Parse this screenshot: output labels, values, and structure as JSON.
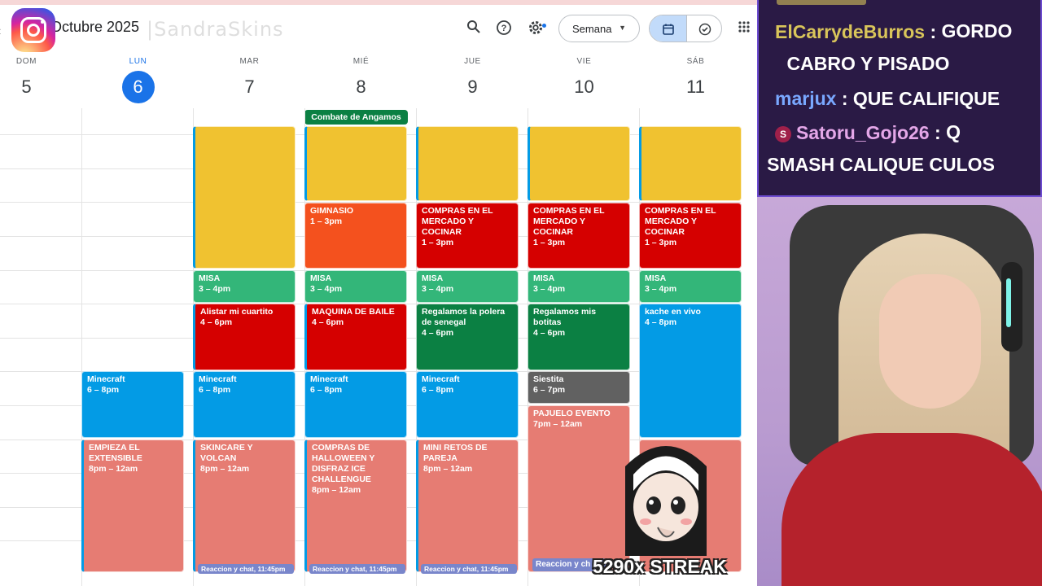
{
  "calendar": {
    "month_title": "Octubre 2025",
    "watermark": "|SandraSkins",
    "view_label": "Semana",
    "days": [
      {
        "name": "DOM",
        "date": "5"
      },
      {
        "name": "LUN",
        "date": "6"
      },
      {
        "name": "MAR",
        "date": "7"
      },
      {
        "name": "MIÉ",
        "date": "8"
      },
      {
        "name": "JUE",
        "date": "9"
      },
      {
        "name": "VIE",
        "date": "10"
      },
      {
        "name": "SÁB",
        "date": "11"
      }
    ],
    "all_day_event": "Combate de Angamos",
    "events": {
      "gimnasio": {
        "title": "GIMNASIO",
        "time": "1 – 3pm"
      },
      "compras_jue": {
        "title": "COMPRAS EN EL MERCADO Y COCINAR",
        "time": "1 – 3pm"
      },
      "compras_vie": {
        "title": "COMPRAS EN EL MERCADO Y COCINAR",
        "time": "1 – 3pm"
      },
      "compras_sab": {
        "title": "COMPRAS EN EL MERCADO Y COCINAR",
        "time": "1 – 3pm"
      },
      "misa_mar": {
        "title": "MISA",
        "time": "3 – 4pm"
      },
      "misa_mie": {
        "title": "MISA",
        "time": "3 – 4pm"
      },
      "misa_jue": {
        "title": "MISA",
        "time": "3 – 4pm"
      },
      "misa_vie": {
        "title": "MISA",
        "time": "3 – 4pm"
      },
      "misa_sab": {
        "title": "MISA",
        "time": "3 – 4pm"
      },
      "alistar": {
        "title": "Alistar mi cuartito",
        "time": "4 – 6pm"
      },
      "maquina": {
        "title": "MAQUINA DE BAILE",
        "time": "4 – 6pm"
      },
      "regalamos_polera": {
        "title": "Regalamos la polera de senegal",
        "time": "4 – 6pm"
      },
      "regalamos_botitas": {
        "title": "Regalamos mis botitas",
        "time": "4 – 6pm"
      },
      "kache": {
        "title": "kache en vivo",
        "time": "4 – 8pm"
      },
      "minecraft_lun": {
        "title": "Minecraft",
        "time": "6 – 8pm"
      },
      "minecraft_mar": {
        "title": "Minecraft",
        "time": "6 – 8pm"
      },
      "minecraft_mie": {
        "title": "Minecraft",
        "time": "6 – 8pm"
      },
      "minecraft_jue": {
        "title": "Minecraft",
        "time": "6 – 8pm"
      },
      "siestita": {
        "title": "Siestita",
        "time": "6 – 7pm"
      },
      "pajuelo": {
        "title": "PAJUELO EVENTO",
        "time": "7pm – 12am"
      },
      "empieza": {
        "title": "EMPIEZA EL EXTENSIBLE",
        "time": "8pm – 12am"
      },
      "skincare": {
        "title": "SKINCARE Y VOLCAN",
        "time": "8pm – 12am"
      },
      "halloween": {
        "title": "COMPRAS DE HALLOWEEN Y DISFRAZ ICE CHALLENGUE",
        "time": "8pm – 12am"
      },
      "retos": {
        "title": "MINI RETOS DE PAREJA",
        "time": "8pm – 12am"
      }
    },
    "chip_label": "Reaccion y chat, 11:45pm",
    "chip_label_short": "Reaccion y ch"
  },
  "chat": [
    {
      "user": "ElCarrydeBurros",
      "message": "GORDO CABRO Y PISADO"
    },
    {
      "user": "marjux",
      "message": "QUE CALIFIQUE"
    },
    {
      "user": "Satoru_Gojo26",
      "message": "Q SMASH CALIQUE CULOS"
    }
  ],
  "overlay": {
    "streak": "5290x STREAK"
  },
  "colors": {
    "banana": "#f0c230",
    "tomato": "#d50000",
    "tangerine": "#f4511e",
    "sage": "#33b679",
    "basil": "#0b8043",
    "peacock": "#039be5",
    "flamingo": "#e67c73",
    "graphite": "#616161",
    "today_blue": "#1a73e8"
  }
}
